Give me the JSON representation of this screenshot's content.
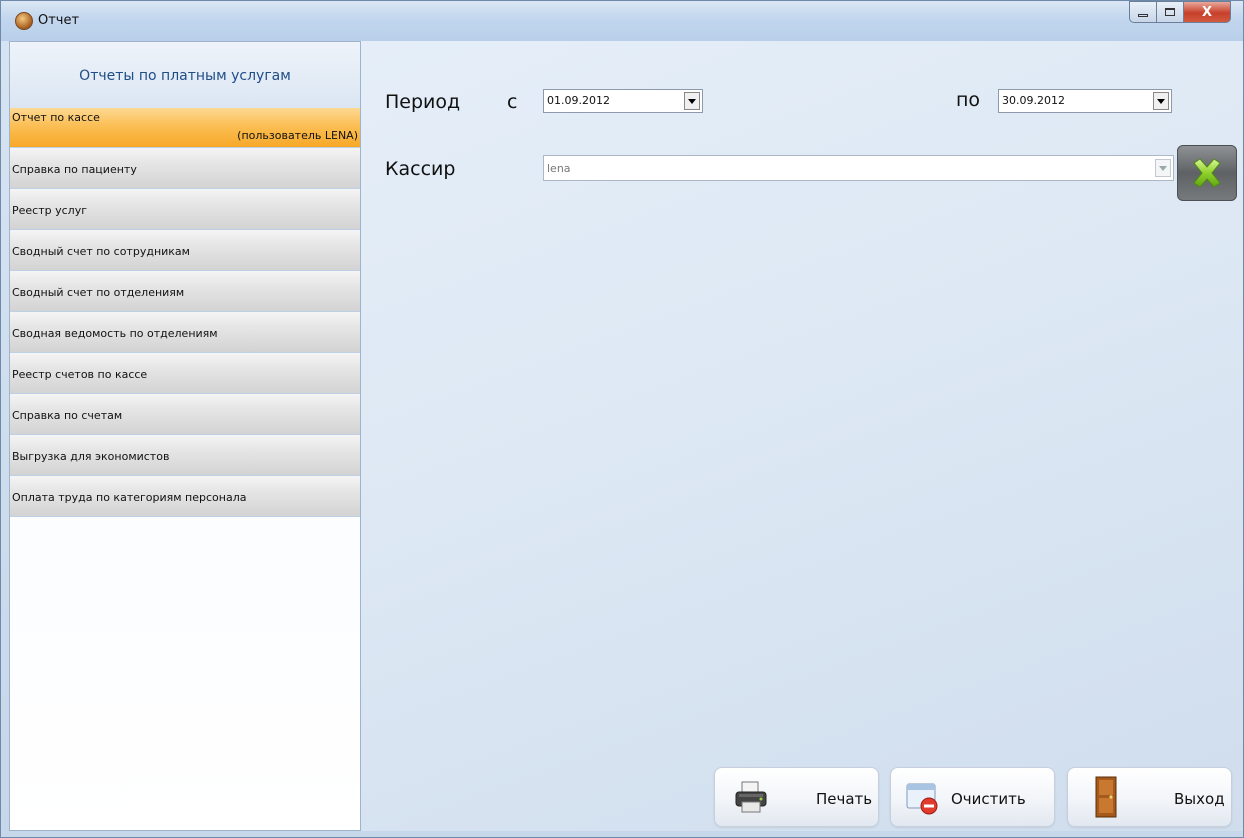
{
  "window": {
    "title": "Отчет",
    "controls": {
      "close_glyph": "X"
    }
  },
  "sidebar": {
    "header": "Отчеты по платным услугам",
    "items": [
      {
        "label": "Отчет по кассе",
        "sub": "(пользователь LENA)",
        "active": true
      },
      {
        "label": "Справка по пациенту"
      },
      {
        "label": "Реестр услуг"
      },
      {
        "label": "Сводный счет по сотрудникам"
      },
      {
        "label": "Сводный счет по отделениям"
      },
      {
        "label": "Сводная ведомость по отделениям"
      },
      {
        "label": "Реестр счетов по кассе"
      },
      {
        "label": "Справка по счетам"
      },
      {
        "label": "Выгрузка для экономистов"
      },
      {
        "label": "Оплата труда по категориям персонала"
      }
    ]
  },
  "form": {
    "period_label": "Период",
    "from_label": "с",
    "from_value": "01.09.2012",
    "to_label": "по",
    "to_value": "30.09.2012",
    "cashier_label": "Кассир",
    "cashier_value": "lena"
  },
  "buttons": {
    "print": "Печать",
    "clear": "Очистить",
    "exit": "Выход"
  },
  "colors": {
    "active_item": "#fbbf55",
    "accent_text": "#1f4d86",
    "clear_icon": "#7ed321"
  },
  "icons": [
    "app-icon",
    "printer-icon",
    "clear-document-icon",
    "door-exit-icon",
    "clear-x-icon",
    "dropdown-arrow-icon"
  ]
}
